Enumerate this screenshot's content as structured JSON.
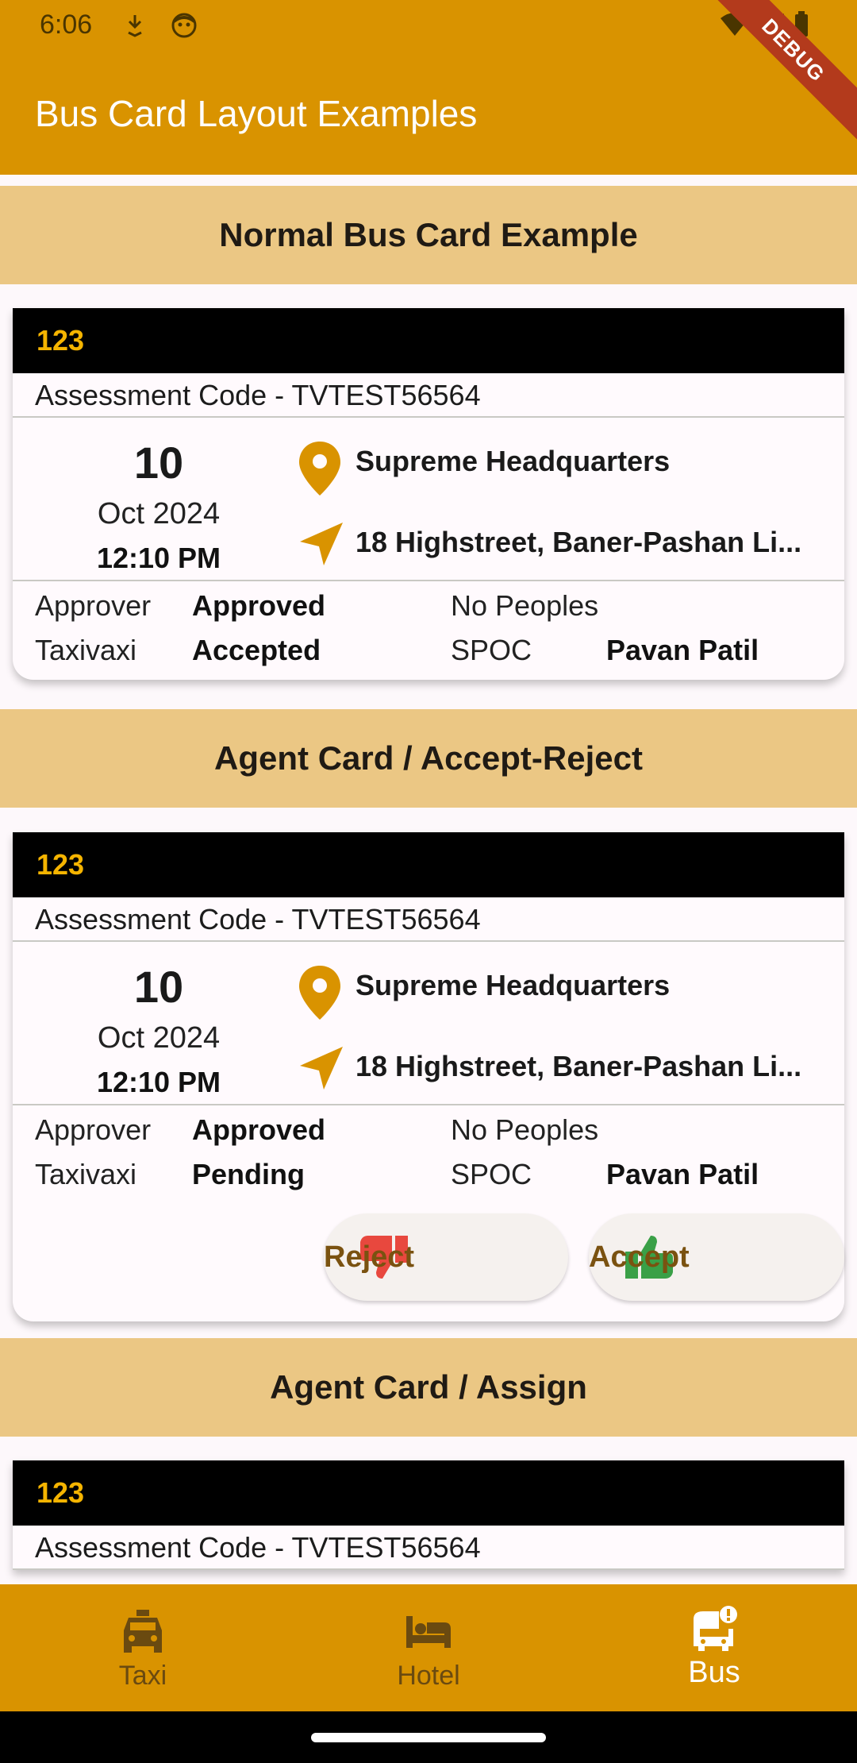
{
  "status": {
    "time": "6:06"
  },
  "appbar": {
    "title": "Bus Card Layout Examples",
    "debug_label": "DEBUG"
  },
  "sections": [
    {
      "title": "Normal Bus Card Example"
    },
    {
      "title": "Agent Card / Accept-Reject"
    },
    {
      "title": "Agent Card / Assign"
    }
  ],
  "cards": [
    {
      "number": "123",
      "assessment": "Assessment Code - TVTEST56564",
      "day": "10",
      "month_year": "Oct 2024",
      "time": "12:10 PM",
      "location": "Supreme Headquarters",
      "address": "18 Highstreet, Baner-Pashan Li...",
      "approver_label": "Approver",
      "approver_value": "Approved",
      "taxi_label": "Taxivaxi",
      "taxi_value": "Accepted",
      "peoples_label": "No Peoples",
      "spoc_label": "SPOC",
      "spoc_value": "Pavan Patil"
    },
    {
      "number": "123",
      "assessment": "Assessment Code - TVTEST56564",
      "day": "10",
      "month_year": "Oct 2024",
      "time": "12:10 PM",
      "location": "Supreme Headquarters",
      "address": "18 Highstreet, Baner-Pashan Li...",
      "approver_label": "Approver",
      "approver_value": "Approved",
      "taxi_label": "Taxivaxi",
      "taxi_value": "Pending",
      "peoples_label": "No Peoples",
      "spoc_label": "SPOC",
      "spoc_value": "Pavan Patil",
      "reject_label": "Reject",
      "accept_label": "Accept"
    },
    {
      "number": "123",
      "assessment": "Assessment Code - TVTEST56564"
    }
  ],
  "bottom_nav": {
    "items": [
      {
        "label": "Taxi",
        "icon": "taxi-icon"
      },
      {
        "label": "Hotel",
        "icon": "hotel-icon"
      },
      {
        "label": "Bus",
        "icon": "bus-alert-icon",
        "active": true
      }
    ]
  },
  "colors": {
    "primary": "#d99300",
    "section_bg": "#ebc784",
    "card_head_bg": "#000000",
    "card_number": "#f5b400",
    "reject": "#e8483e",
    "accept": "#3aa047"
  }
}
